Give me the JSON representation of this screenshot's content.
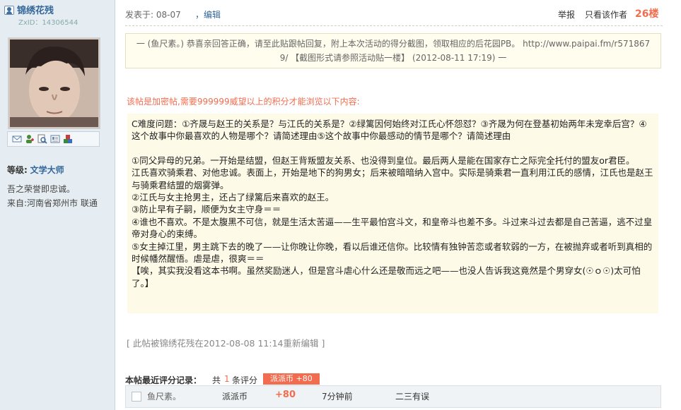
{
  "sidebar": {
    "username": "锦绣花残",
    "zxid": "ZxID：14306544",
    "level_label": "等级:",
    "level_value": "文学大师",
    "motto": "吾之荣誉即忠诚。",
    "from": "来自:河南省郑州市 联通",
    "icons": [
      "mail-icon",
      "add-friend-icon",
      "search-icon",
      "profile-card-icon",
      "puzzle-icon"
    ]
  },
  "post": {
    "posted": "发表于: 08-07",
    "edit": "，编辑",
    "report": "举报",
    "only_author": "只看该作者",
    "floor": "26楼",
    "notice_line1": "一 (鱼尺素。) 恭喜亲回答正确，请至此贴跟帖回复，附上本次活动的得分截图，领取相应的后花园PB。 http://www.paipai.fm/r571867",
    "notice_line2": "9/ 【截图形式请参照活动贴一楼】 (2012-08-11 17:19) 一",
    "locked_text": "该帖是加密帖,需要999999威望以上的积分才能浏览以下内容:",
    "content": [
      "C难度问题：①齐晟与赵王的关系是？与江氏的关系是？②绿篱因何始终对江氏心怀怨怼？③齐晟为何在登基初始两年未宠幸后宫？④这个故事中你最喜欢的人物是哪个？请简述理由⑤这个故事中你最感动的情节是哪个？请简述理由",
      "",
      "①同父异母的兄弟。一开始是结盟，但赵王背叛盟友关系、也没得到皇位。最后两人是能在国家存亡之际完全托付的盟友or君臣。",
      "江氏喜欢骑乘君、对他忠诚。表面上，开始是地下的狗男女；后来被暗暗纳入宫中。实际是骑乘君一直利用江氏的感情，江氏也是赵王与骑乘君结盟的烟雾弹。",
      "②江氏与女主抢男主，还占了绿篱后来喜欢的赵王。",
      "③防止早有子嗣，顺便为女主守身＝＝",
      "④谁也不喜欢。不是太腹黑不可信，就是生活太苦逼——生平最怕宫斗文，和皇帝斗也差不多。斗过来斗过去都是自己苦逼，逃不过皇帝对身心的束缚。",
      "⑤女主掉江里，男主跳下去的晚了——让你晚让你晚，看以后谁还信你。比较情有独钟苦恋或者软弱的一方，在被抛弃或者听到真相的时候幡然醒悟。虐是虐，很爽＝＝",
      "【唉，其实我没看这本书啊。虽然奖励迷人，但是宫斗虐心什么还是敬而远之吧——也没人告诉我这竟然是个男穿女(☉ｏ☉)太可怕了。】"
    ],
    "edited_note": "[ 此帖被锦绣花残在2012-08-08 11:14重新编辑 ]"
  },
  "rating": {
    "title": "本帖最近评分记录：",
    "prefix": "共",
    "count": "1",
    "suffix": "条评分",
    "badge": "派派币 +80",
    "rows": [
      {
        "name": "鱼尺素。",
        "currency": "派派币",
        "points": "+80",
        "time": "7分钟前",
        "reason": "二三有误"
      }
    ]
  },
  "colors": {
    "sidebar_bg": "#e5edf2",
    "accent_red": "#f26c4f",
    "link_blue": "#336699",
    "quote_bg": "#fdfbe7"
  }
}
